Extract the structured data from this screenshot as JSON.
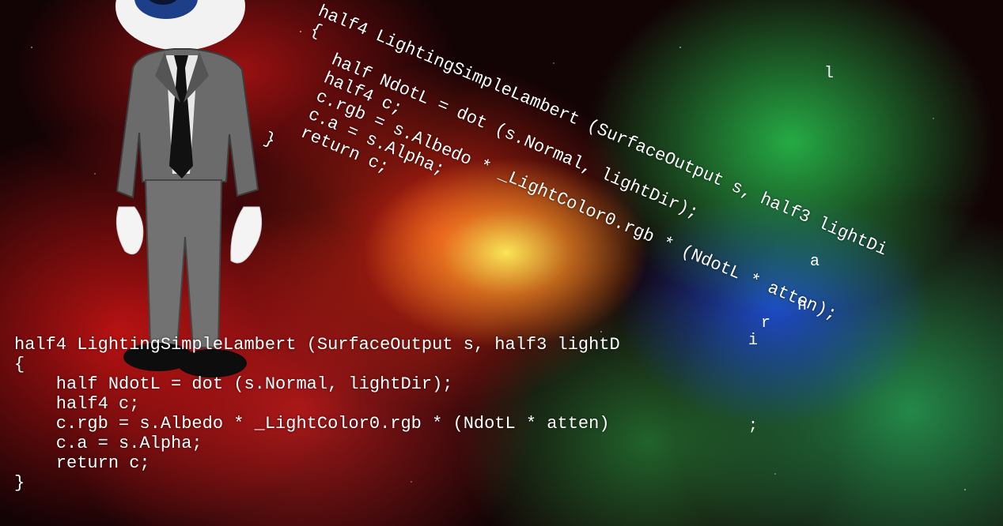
{
  "scene": {
    "description_colors": {
      "red_nebula": "#d41c14",
      "green_nebula": "#2fc85a",
      "blue_nebula": "#2a56e0",
      "yellow_core": "#ffe866"
    }
  },
  "code_main": {
    "lines": [
      "half4 LightingSimpleLambert (SurfaceOutput s, half3 lightD",
      "{",
      "    half NdotL = dot (s.Normal, lightDir);",
      "    half4 c;",
      "    c.rgb = s.Albedo * _LightColor0.rgb * (NdotL * atten)",
      "    c.a = s.Alpha;",
      "    return c;",
      "}"
    ]
  },
  "code_tilted": {
    "lines": [
      "half4 LightingSimpleLambert (SurfaceOutput s, half3 lightDi",
      "{",
      "   half NdotL = dot (s.Normal, lightDir);",
      "   half4 c;",
      "   c.rgb = s.Albedo * _LightColor0.rgb * (NdotL * atten);",
      "   c.a = s.Alpha;",
      "   return c;",
      "}"
    ]
  },
  "stray_chars": {
    "l": "l",
    "a": "a",
    "h": "h",
    "i": "i",
    "r": "r",
    "semicolon": ";"
  }
}
